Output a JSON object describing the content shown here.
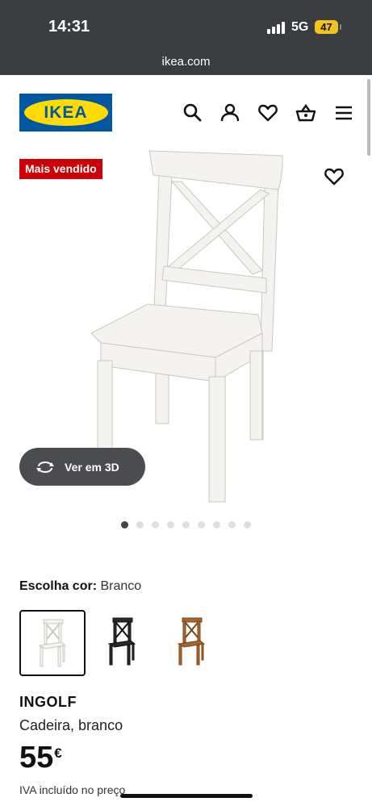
{
  "status": {
    "time": "14:31",
    "network": "5G",
    "battery": "47"
  },
  "browser": {
    "url": "ikea.com"
  },
  "header": {
    "logo_text": "IKEA",
    "icons": [
      "search-icon",
      "account-icon",
      "favourites-icon",
      "basket-icon",
      "menu-icon"
    ]
  },
  "product": {
    "badge": "Mais vendido",
    "view3d_label": "Ver em 3D",
    "carousel": {
      "total": 9,
      "active": 1
    },
    "color_label": "Escolha cor:",
    "color_value": "Branco",
    "swatches": [
      {
        "name": "Branco",
        "color": "#f5f4f0",
        "selected": true
      },
      {
        "name": "Preto",
        "color": "#2a2a2a",
        "selected": false
      },
      {
        "name": "Castanho",
        "color": "#a8662e",
        "selected": false
      }
    ],
    "name": "INGOLF",
    "description": "Cadeira, branco",
    "price": "55",
    "currency": "€",
    "tax_note": "IVA incluído no preço"
  },
  "colors": {
    "brand_blue": "#0058a3",
    "brand_yellow": "#ffdb00",
    "badge_red": "#cc0008"
  }
}
